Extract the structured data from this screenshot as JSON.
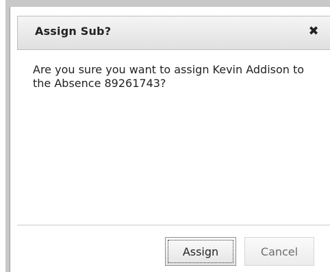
{
  "dialog": {
    "title": "Assign Sub?",
    "close_glyph": "✖",
    "close_icon": "close-icon",
    "message": "Are you sure you want to assign Kevin Addison to the Absence 89261743?",
    "buttons": {
      "assign_label": "Assign",
      "cancel_label": "Cancel"
    }
  },
  "colors": {
    "frame_border": "#c8c8c8",
    "titlebar_top": "#f5f5f5",
    "titlebar_bottom": "#e0e0e0",
    "text": "#222222",
    "cancel_text": "#6e6e6e"
  }
}
